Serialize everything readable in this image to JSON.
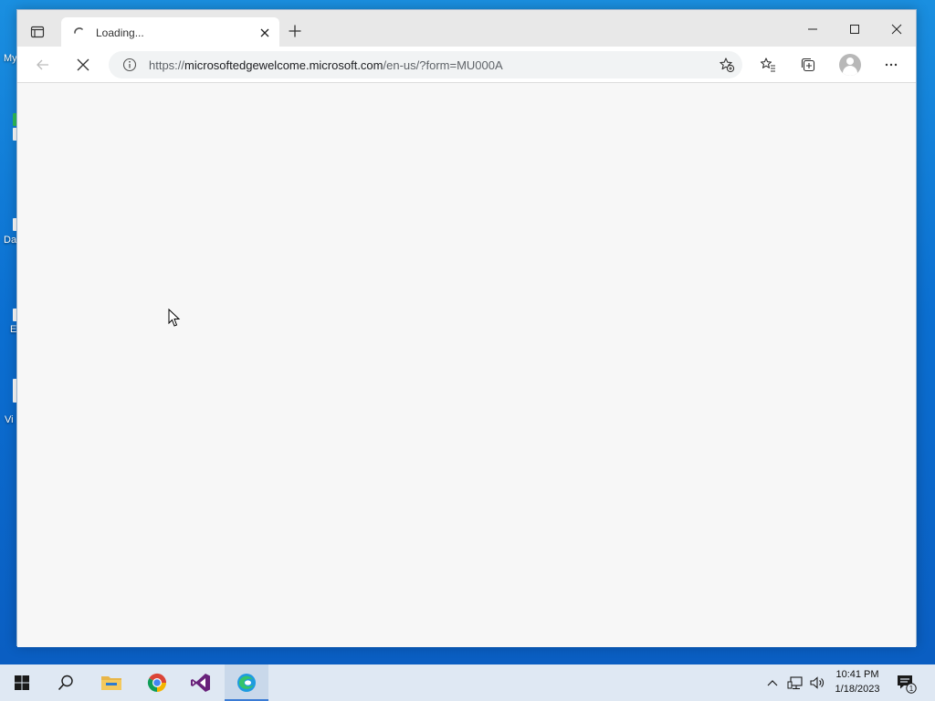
{
  "desktop": {
    "icons": [
      {
        "label": "My",
        "name": "desktop-icon-my"
      },
      {
        "label": "",
        "name": "desktop-icon-app"
      },
      {
        "label": "Da",
        "name": "desktop-icon-da"
      },
      {
        "label": "E",
        "name": "desktop-icon-e"
      },
      {
        "label": "Vi",
        "name": "desktop-icon-vi"
      }
    ]
  },
  "browser": {
    "tab": {
      "title": "Loading...",
      "icon": "loading-spinner-icon"
    },
    "address": {
      "scheme": "https://",
      "host": "microsoftedgewelcome.microsoft.com",
      "path": "/en-us/?form=MU000A"
    },
    "colors": {
      "accent": "#0078d4",
      "window_bg": "#f7f7f7"
    }
  },
  "taskbar": {
    "apps": [
      {
        "name": "taskbar-start",
        "icon": "windows-logo-icon"
      },
      {
        "name": "taskbar-search",
        "icon": "search-icon"
      },
      {
        "name": "taskbar-file-explorer",
        "icon": "folder-icon"
      },
      {
        "name": "taskbar-chrome",
        "icon": "chrome-icon"
      },
      {
        "name": "taskbar-visual-studio",
        "icon": "visual-studio-icon"
      },
      {
        "name": "taskbar-edge",
        "icon": "edge-icon",
        "active": true
      }
    ],
    "clock": {
      "time": "10:41 PM",
      "date": "1/18/2023"
    },
    "notification_count": "1"
  }
}
